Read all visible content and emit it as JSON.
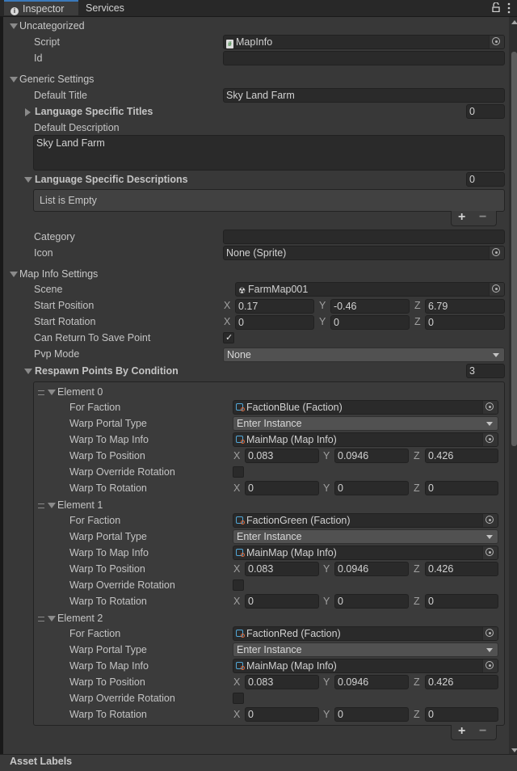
{
  "tabs": [
    {
      "label": "Inspector",
      "icon": "info-icon",
      "active": true
    },
    {
      "label": "Services",
      "active": false
    }
  ],
  "header_icons": [
    "lock-icon",
    "kebab-menu-icon"
  ],
  "colors": {
    "accent": "#3a79bb",
    "background": "#383838",
    "field": "#2a2a2a"
  },
  "sections": {
    "uncategorized": {
      "title": "Uncategorized",
      "script_label": "Script",
      "script_value": "MapInfo",
      "id_label": "Id",
      "id_value": ""
    },
    "generic": {
      "title": "Generic Settings",
      "default_title_label": "Default Title",
      "default_title_value": "Sky Land Farm",
      "lang_titles_label": "Language Specific Titles",
      "lang_titles_count": "0",
      "default_desc_label": "Default Description",
      "default_desc_value": "Sky Land Farm",
      "lang_desc_label": "Language Specific Descriptions",
      "lang_desc_count": "0",
      "empty_list_text": "List is Empty",
      "category_label": "Category",
      "category_value": "",
      "icon_label": "Icon",
      "icon_value": "None (Sprite)"
    },
    "mapinfo": {
      "title": "Map Info Settings",
      "scene_label": "Scene",
      "scene_value": "FarmMap001",
      "start_pos_label": "Start Position",
      "start_pos": {
        "x": "0.17",
        "y": "-0.46",
        "z": "6.79"
      },
      "start_rot_label": "Start Rotation",
      "start_rot": {
        "x": "0",
        "y": "0",
        "z": "0"
      },
      "can_return_label": "Can Return To Save Point",
      "can_return_checked": true,
      "pvp_label": "Pvp Mode",
      "pvp_value": "None",
      "respawn_label": "Respawn Points By Condition",
      "respawn_count": "3"
    }
  },
  "axis_labels": {
    "x": "X",
    "y": "Y",
    "z": "Z"
  },
  "field_labels": {
    "for_faction": "For Faction",
    "warp_portal_type": "Warp Portal Type",
    "warp_to_map_info": "Warp To Map Info",
    "warp_to_position": "Warp To Position",
    "warp_override_rotation": "Warp Override Rotation",
    "warp_to_rotation": "Warp To Rotation"
  },
  "elements": [
    {
      "title": "Element 0",
      "faction": "FactionBlue (Faction)",
      "portal_type": "Enter Instance",
      "map_info": "MainMap (Map Info)",
      "pos": {
        "x": "0.083",
        "y": "0.0946",
        "z": "0.426"
      },
      "override_rotation": false,
      "rot": {
        "x": "0",
        "y": "0",
        "z": "0"
      }
    },
    {
      "title": "Element 1",
      "faction": "FactionGreen (Faction)",
      "portal_type": "Enter Instance",
      "map_info": "MainMap (Map Info)",
      "pos": {
        "x": "0.083",
        "y": "0.0946",
        "z": "0.426"
      },
      "override_rotation": false,
      "rot": {
        "x": "0",
        "y": "0",
        "z": "0"
      }
    },
    {
      "title": "Element 2",
      "faction": "FactionRed (Faction)",
      "portal_type": "Enter Instance",
      "map_info": "MainMap (Map Info)",
      "pos": {
        "x": "0.083",
        "y": "0.0946",
        "z": "0.426"
      },
      "override_rotation": false,
      "rot": {
        "x": "0",
        "y": "0",
        "z": "0"
      }
    }
  ],
  "list_buttons": {
    "add": "+",
    "remove": "−"
  },
  "footer": {
    "asset_labels": "Asset Labels"
  }
}
